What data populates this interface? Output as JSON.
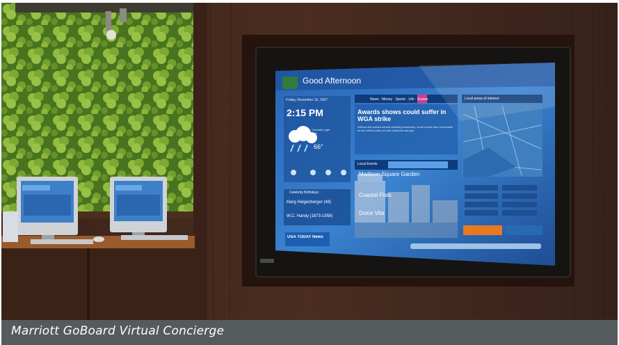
{
  "caption": "Marriott GoBoard Virtual Concierge",
  "screen": {
    "greeting": "Good Afternoon",
    "date": "Friday, November 16, 2007",
    "time": "2:15 PM",
    "weather_condition": "Currently Light Rain",
    "temperature": "66°",
    "news_tabs": [
      "News",
      "Money",
      "Sports",
      "Life",
      "Scores"
    ],
    "active_tab": "Life",
    "headline": "Awards shows could suffer in WGA strike",
    "headline_body": "Without the scribes behind celebrity presenters, some shows face uncertainty as the writers walk out over residuals and pay",
    "map_title": "Local areas of interest",
    "local_events_label": "Local Events",
    "events": [
      "Madison Square Garden",
      "Coastal Flats",
      "Dolce Vita"
    ],
    "birthdays_title": "Celebrity Birthdays",
    "birthdays": [
      "Marg Helgenberger (48)",
      "W.C. Handy (1873-1958)"
    ],
    "brand": "USA TODAY News"
  },
  "colors": {
    "wall": "#3a2218",
    "frame": "#1b1714",
    "screen_blue": "#2f6fbf",
    "caption_bar": "#555a5c",
    "accent": "#e87a1e",
    "clover": "#8fbf3a"
  }
}
